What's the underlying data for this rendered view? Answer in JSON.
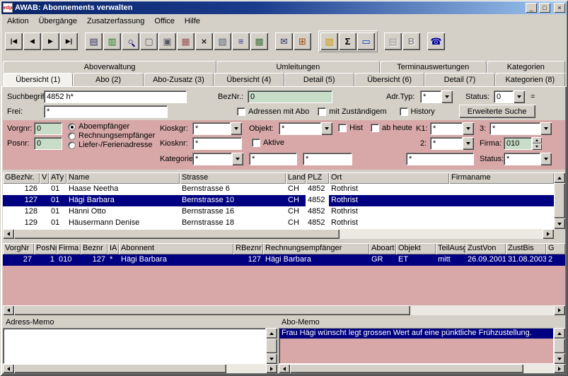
{
  "theme": {
    "selection": "#000080",
    "panel_pink": "#d8a8a8",
    "field_green": "#c8ddc8",
    "window_gray": "#d4d0c8",
    "titlebar_blue": "#0a246a"
  },
  "window": {
    "icon_text": "edp",
    "title": "AWAB: Abonnements verwalten",
    "minimize_glyph": "_",
    "maximize_glyph": "□",
    "close_glyph": "×"
  },
  "menubar": {
    "items": [
      "Aktion",
      "Übergänge",
      "Zusatzerfassung",
      "Office",
      "Hilfe"
    ]
  },
  "toolbar": {
    "buttons": [
      {
        "name": "first-record",
        "glyph": "|◀"
      },
      {
        "name": "previous-record",
        "glyph": "◀"
      },
      {
        "name": "next-record",
        "glyph": "▶"
      },
      {
        "name": "last-record",
        "glyph": "▶|"
      },
      {
        "name": "print",
        "glyph": "▤"
      },
      {
        "name": "open-report",
        "glyph": "▥"
      },
      {
        "name": "search",
        "glyph": "○"
      },
      {
        "name": "new-record",
        "glyph": "▢"
      },
      {
        "name": "copy-record",
        "glyph": "▣"
      },
      {
        "name": "save-record",
        "glyph": "▦"
      },
      {
        "name": "delete-record",
        "glyph": "×"
      },
      {
        "name": "document-list",
        "glyph": "▧"
      },
      {
        "name": "list-view",
        "glyph": "≡"
      },
      {
        "name": "edit-table",
        "glyph": "▩"
      },
      {
        "name": "mail",
        "glyph": "✉"
      },
      {
        "name": "calendar",
        "glyph": "⊞"
      },
      {
        "name": "note",
        "glyph": "▨"
      },
      {
        "name": "sum",
        "glyph": "Σ"
      },
      {
        "name": "memo",
        "glyph": "▭"
      },
      {
        "name": "print-preview",
        "glyph": "▤"
      },
      {
        "name": "letter",
        "glyph": "B"
      },
      {
        "name": "phone",
        "glyph": "☎"
      }
    ]
  },
  "tabs_row1": {
    "items": [
      "Aboverwaltung",
      "Umleitungen",
      "Terminauswertungen",
      "Kategorien"
    ]
  },
  "tabs_row2": {
    "items": [
      "Übersicht (1)",
      "Abo (2)",
      "Abo-Zusatz (3)",
      "Übersicht (4)",
      "Detail (5)",
      "Übersicht (6)",
      "Detail (7)",
      "Kategorien (8)"
    ],
    "active": "Übersicht (1)"
  },
  "search": {
    "suchbegriff_label": "Suchbegriff:",
    "suchbegriff_value": "4852 h*",
    "beznr_label": "BezNr.:",
    "beznr_value": "0",
    "adrtyp_label": "Adr.Typ:",
    "adrtyp_value": "*",
    "status_label": "Status:",
    "status_value": "0",
    "equals_label": "=",
    "frei_label": "Frei:",
    "frei_value": "*",
    "checkbox_adressen_mit_abo": "Adressen mit Abo",
    "checkbox_mit_zustaendigem": "mit Zuständigem",
    "checkbox_history": "History",
    "erweiterte_suche_label": "Erweiterte Suche"
  },
  "filters": {
    "vorgnr_label": "Vorgnr:",
    "vorgnr_value": "0",
    "posnr_label": "Posnr:",
    "posnr_value": "0",
    "radio_aboempfaenger": "Aboempfänger",
    "radio_rechnungsempfaenger": "Rechnungsempfänger",
    "radio_liefer": "Liefer-/Ferienadresse",
    "radio_selected": "Aboempfänger",
    "kioskgr_label": "Kioskgr:",
    "kioskgr_value": "*",
    "kiosknr_label": "Kiosknr:",
    "kiosknr_value": "*",
    "kategorie_label": "Kategorie:",
    "kategorie_value": "*",
    "objekt_label": "Objekt:",
    "objekt_value": "*",
    "hist_label": "Hist",
    "ab_heute_label": "ab heute",
    "aktive_label": "Aktive",
    "k1_label": "K1:",
    "k1_value": "*",
    "k2_label": "2:",
    "k2_value": "*",
    "k3_label": "3:",
    "k3_value": "*",
    "firma_label": "Firma:",
    "firma_value": "010",
    "status_label": "Status:",
    "status_value": "*",
    "extra1_value": "*",
    "extra2_value": "*",
    "extra3_value": "*"
  },
  "address_table": {
    "columns": [
      "GBezNr.",
      "V",
      "ATy",
      "Name",
      "Strasse",
      "Land",
      "PLZ",
      "Ort",
      "Firmaname"
    ],
    "rows": [
      [
        "126",
        "",
        "01",
        "Haase Neetha",
        "Bernstrasse 6",
        "CH",
        "4852",
        "Rothrist",
        ""
      ],
      [
        "127",
        "",
        "01",
        "Hägi Barbara",
        "Bernstrasse 10",
        "CH",
        "4852",
        "Rothrist",
        ""
      ],
      [
        "128",
        "",
        "01",
        "Hänni Otto",
        "Bernstrasse 16",
        "CH",
        "4852",
        "Rothrist",
        ""
      ],
      [
        "129",
        "",
        "01",
        "Häusermann Denise",
        "Bernstrasse 18",
        "CH",
        "4852",
        "Rothrist",
        ""
      ]
    ],
    "selected_row": 1
  },
  "abo_table": {
    "columns": [
      "VorgNr",
      "PosNr",
      "Firma",
      "Beznr",
      "IA",
      "Abonnent",
      "RBeznr",
      "Rechnungsempfänger",
      "Aboart",
      "Objekt",
      "TeilAusg",
      "ZustVon",
      "ZustBis",
      "G"
    ],
    "rows": [
      [
        "27",
        "1",
        "010",
        "127",
        "*",
        "Hägi Barbara",
        "127",
        "Hägi Barbara",
        "GR",
        "ET",
        "mitt",
        "26.09.2001",
        "31.08.2003",
        "2"
      ]
    ],
    "selected_row": 0
  },
  "memos": {
    "adress_label": "Adress-Memo",
    "adress_text": "",
    "abo_label": "Abo-Memo",
    "abo_text": "Frau Hägi wünscht legt grossen Wert auf eine pünktliche Frühzustellung."
  }
}
